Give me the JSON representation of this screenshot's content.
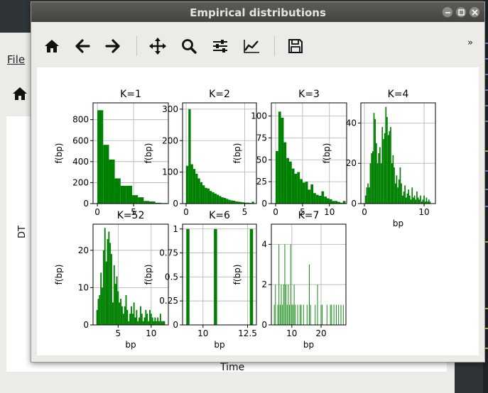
{
  "window": {
    "title": "Empirical distributions",
    "more_label": "»",
    "toolbar": [
      {
        "icon": "home-icon"
      },
      {
        "icon": "back-arrow-icon"
      },
      {
        "icon": "forward-arrow-icon"
      },
      {
        "icon": "pan-icon"
      },
      {
        "icon": "zoom-icon"
      },
      {
        "icon": "subplots-icon"
      },
      {
        "icon": "edit-axis-icon"
      },
      {
        "icon": "save-icon"
      }
    ]
  },
  "background_window": {
    "menu_file": "File",
    "ylabel": "DT",
    "xlabel": "Time"
  },
  "colors": {
    "bars": "#008000",
    "grid": "#b0b0b0"
  },
  "chart_data": [
    {
      "type": "bar",
      "title": "K=1",
      "ylabel": "f(bp)",
      "xlabel": "",
      "xlim": [
        -0.6,
        9.8
      ],
      "ylim": [
        0,
        960
      ],
      "xticks": [
        0,
        5
      ],
      "yticks": [
        0,
        200,
        400,
        600,
        800
      ],
      "x": [
        0.4,
        1.2,
        2.0,
        2.8,
        3.6,
        4.4,
        5.2,
        6.0,
        6.8,
        7.6,
        8.4,
        9.2
      ],
      "values": [
        890,
        560,
        420,
        240,
        170,
        170,
        80,
        60,
        25,
        20,
        8,
        5
      ]
    },
    {
      "type": "bar",
      "title": "K=2",
      "ylabel": "f(bp)",
      "xlabel": "",
      "xlim": [
        -0.3,
        6.0
      ],
      "ylim": [
        0,
        320
      ],
      "xticks": [
        0,
        5
      ],
      "yticks": [
        0,
        100,
        200,
        300
      ],
      "x": [
        0.1,
        0.3,
        0.5,
        0.7,
        0.9,
        1.1,
        1.3,
        1.5,
        1.7,
        1.9,
        2.1,
        2.3,
        2.5,
        2.7,
        2.9,
        3.1,
        3.3,
        3.5,
        3.7,
        3.9,
        4.1,
        4.3,
        4.5,
        4.7,
        4.9,
        5.1,
        5.3,
        5.5,
        5.7
      ],
      "values": [
        120,
        300,
        125,
        110,
        95,
        80,
        68,
        58,
        50,
        48,
        40,
        36,
        32,
        28,
        24,
        20,
        18,
        15,
        12,
        10,
        9,
        7,
        6,
        5,
        4,
        3,
        3,
        2,
        6
      ]
    },
    {
      "type": "bar",
      "title": "K=3",
      "ylabel": "f(bp)",
      "xlabel": "",
      "xlim": [
        -0.8,
        13.2
      ],
      "ylim": [
        0,
        115
      ],
      "xticks": [
        0,
        5,
        10
      ],
      "yticks": [
        0,
        25,
        50,
        75,
        100
      ],
      "x": [
        0.25,
        0.75,
        1.25,
        1.75,
        2.25,
        2.75,
        3.25,
        3.75,
        4.25,
        4.75,
        5.25,
        5.75,
        6.25,
        6.75,
        7.25,
        7.75,
        8.25,
        8.75,
        9.25,
        9.75,
        10.25,
        10.75,
        11.25,
        11.75,
        12.25,
        12.75
      ],
      "values": [
        60,
        105,
        98,
        70,
        52,
        48,
        40,
        34,
        36,
        28,
        24,
        25,
        16,
        22,
        12,
        10,
        9,
        14,
        8,
        6,
        5,
        3,
        3,
        2,
        1,
        3
      ]
    },
    {
      "type": "bar",
      "title": "K=4",
      "ylabel": "f(bp)",
      "xlabel": "bp",
      "xlim": [
        -0.6,
        11.9
      ],
      "ylim": [
        0,
        50
      ],
      "xticks": [
        0,
        10
      ],
      "yticks": [
        0,
        20,
        40
      ],
      "x": [
        0.2,
        0.4,
        0.6,
        0.8,
        1.0,
        1.2,
        1.4,
        1.6,
        1.8,
        2.0,
        2.2,
        2.4,
        2.6,
        2.8,
        3.0,
        3.2,
        3.4,
        3.6,
        3.8,
        4.0,
        4.2,
        4.4,
        4.6,
        4.8,
        5.0,
        5.2,
        5.4,
        5.6,
        5.8,
        6.0,
        6.2,
        6.4,
        6.6,
        6.8,
        7.0,
        7.2,
        7.4,
        7.6,
        7.8,
        8.0,
        8.2,
        8.4,
        8.6,
        8.8,
        9.0,
        9.2,
        9.4,
        9.6,
        9.8,
        10.0,
        10.2,
        10.4,
        10.6,
        10.8,
        11.0
      ],
      "values": [
        4,
        8,
        10,
        8,
        20,
        25,
        26,
        45,
        42,
        30,
        20,
        25,
        28,
        20,
        38,
        32,
        35,
        48,
        43,
        34,
        36,
        38,
        20,
        24,
        18,
        10,
        14,
        8,
        12,
        18,
        10,
        4,
        6,
        9,
        3,
        5,
        7,
        4,
        2,
        8,
        3,
        4,
        2,
        6,
        3,
        2,
        4,
        1,
        2,
        4,
        1,
        3,
        1,
        2,
        1
      ]
    },
    {
      "type": "bar",
      "title": "K=52",
      "ylabel": "f(bp)",
      "xlabel": "bp",
      "xlim": [
        1.2,
        12.6
      ],
      "ylim": [
        0,
        27
      ],
      "xticks": [
        5,
        10
      ],
      "yticks": [
        0,
        10,
        20
      ],
      "x": [
        1.8,
        2.0,
        2.2,
        2.4,
        2.6,
        2.8,
        3.0,
        3.2,
        3.4,
        3.6,
        3.8,
        4.0,
        4.2,
        4.4,
        4.6,
        4.8,
        5.0,
        5.2,
        5.4,
        5.6,
        5.8,
        6.0,
        6.2,
        6.4,
        6.6,
        6.8,
        7.0,
        7.2,
        7.4,
        7.6,
        7.8,
        8.0,
        8.2,
        8.4,
        8.6,
        8.8,
        9.0,
        9.2,
        9.4,
        9.6,
        9.8,
        10.0,
        10.2,
        10.4,
        10.6,
        10.8,
        11.0,
        11.2,
        11.4,
        11.6,
        11.8,
        12.0
      ],
      "values": [
        4,
        7,
        8,
        14,
        10,
        20,
        26,
        17,
        23,
        25,
        22,
        19,
        6,
        16,
        11,
        13,
        9,
        6,
        7,
        5,
        3,
        5,
        8,
        4,
        1,
        3,
        5,
        3,
        6,
        2,
        4,
        1,
        2,
        5,
        3,
        1,
        2,
        4,
        3,
        1,
        4,
        3,
        2,
        1,
        2,
        1,
        2,
        1,
        3,
        1,
        1,
        1
      ]
    },
    {
      "type": "bar",
      "title": "K=6",
      "ylabel": "f(bp)",
      "xlabel": "bp",
      "xlim": [
        8.85,
        13.0
      ],
      "ylim": [
        0,
        1.05
      ],
      "xticks": [
        10.0,
        12.5
      ],
      "yticks": [
        0.0,
        0.25,
        0.5,
        0.75,
        1.0
      ],
      "x": [
        9.15,
        10.7,
        12.72
      ],
      "values": [
        1.0,
        1.0,
        1.0
      ],
      "bar_width": 0.18
    },
    {
      "type": "bar",
      "title": "K=7",
      "ylabel": "f(bp)",
      "xlabel": "bp",
      "xlim": [
        3.0,
        28.5
      ],
      "ylim": [
        0,
        5.0
      ],
      "xticks": [
        10,
        20
      ],
      "yticks": [
        0,
        2,
        4
      ],
      "x": [
        4.0,
        4.4,
        5.2,
        5.6,
        6.0,
        6.4,
        6.8,
        7.2,
        7.6,
        8.0,
        8.4,
        8.8,
        9.2,
        9.6,
        10.0,
        10.4,
        10.8,
        11.2,
        12.0,
        12.8,
        13.2,
        14.0,
        15.2,
        16.0,
        16.4,
        18.0,
        18.8,
        20.0,
        20.4,
        22.0,
        23.2,
        23.6,
        24.4,
        25.2,
        26.0,
        26.8,
        27.6
      ],
      "values": [
        1,
        2,
        1,
        4,
        1,
        2,
        1,
        2,
        4,
        2,
        1,
        2,
        1,
        4,
        1,
        1,
        2,
        1,
        1,
        1,
        1,
        1,
        1,
        3,
        1,
        1,
        2,
        1,
        1,
        1,
        1,
        1,
        1,
        1,
        1,
        1,
        1
      ],
      "bar_width": 0.22
    }
  ]
}
